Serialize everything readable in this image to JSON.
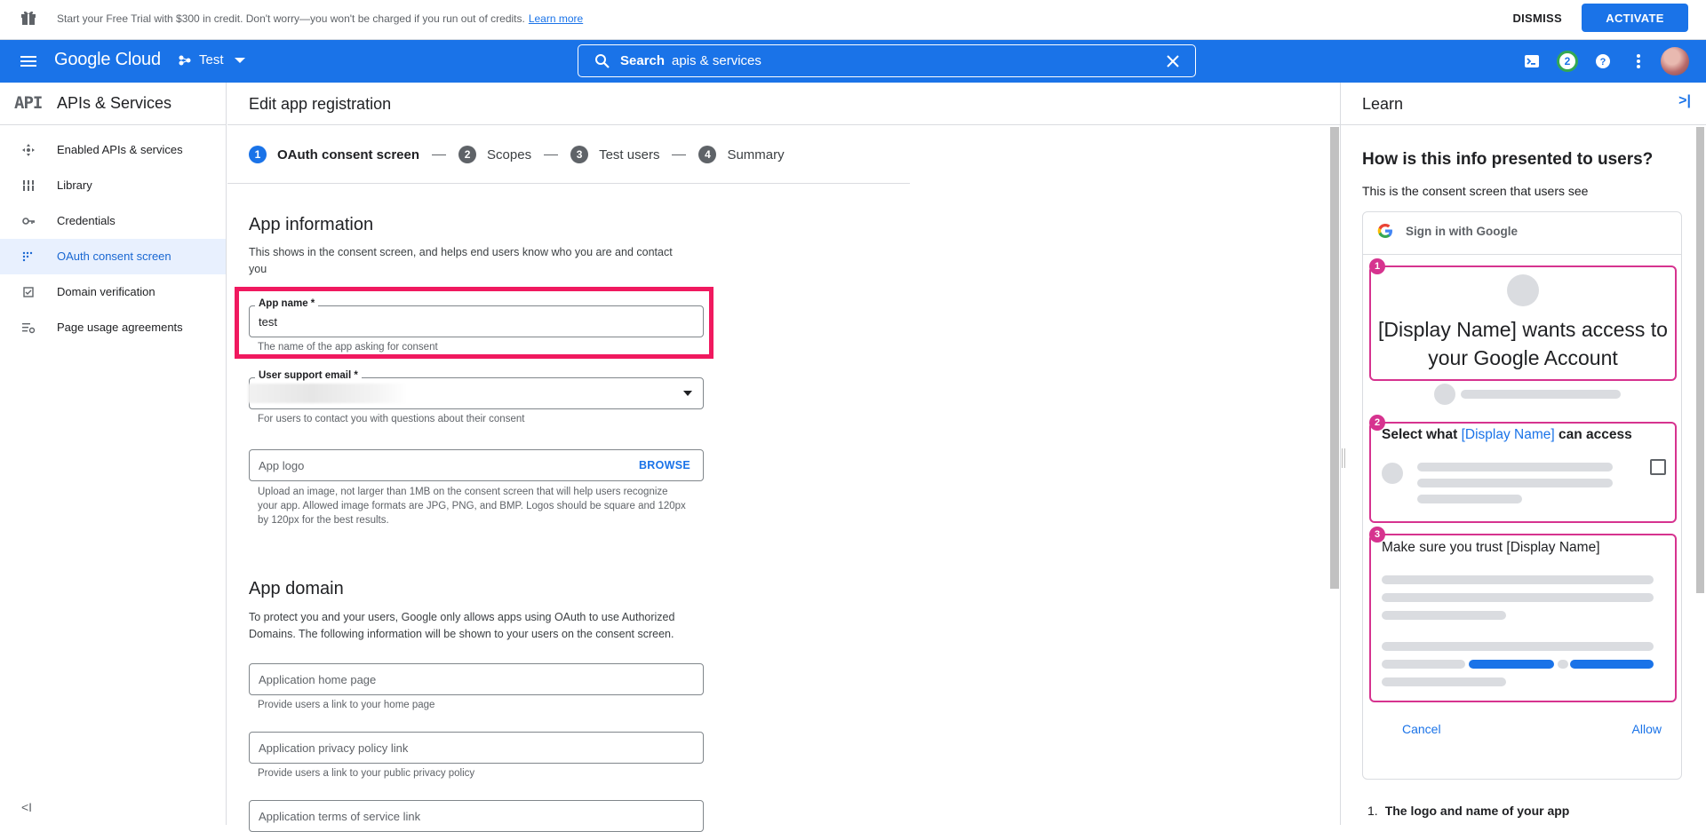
{
  "promo": {
    "text": "Start your Free Trial with $300 in credit. Don't worry—you won't be charged if you run out of credits.",
    "link": "Learn more",
    "dismiss": "DISMISS",
    "activate": "ACTIVATE"
  },
  "topbar": {
    "logo": "Google Cloud",
    "project": "Test",
    "search_label": "Search",
    "search_value": "apis & services",
    "notifications": "2"
  },
  "sidebar": {
    "logo": "API",
    "title": "APIs & Services",
    "items": [
      {
        "label": "Enabled APIs & services",
        "icon": "diamond-arrows-icon"
      },
      {
        "label": "Library",
        "icon": "library-icon"
      },
      {
        "label": "Credentials",
        "icon": "key-icon"
      },
      {
        "label": "OAuth consent screen",
        "icon": "consent-dots-icon"
      },
      {
        "label": "Domain verification",
        "icon": "checkbox-icon"
      },
      {
        "label": "Page usage agreements",
        "icon": "settings-list-icon"
      }
    ],
    "collapse": "<I"
  },
  "main": {
    "title": "Edit app registration",
    "steps": [
      {
        "num": "1",
        "label": "OAuth consent screen"
      },
      {
        "num": "2",
        "label": "Scopes"
      },
      {
        "num": "3",
        "label": "Test users"
      },
      {
        "num": "4",
        "label": "Summary"
      }
    ],
    "app_info": {
      "heading": "App information",
      "desc": "This shows in the consent screen, and helps end users know who you are and contact you",
      "app_name_label": "App name *",
      "app_name_value": "test",
      "app_name_hint": "The name of the app asking for consent",
      "email_label": "User support email *",
      "email_hint": "For users to contact you with questions about their consent",
      "logo_placeholder": "App logo",
      "browse": "BROWSE",
      "logo_hint": "Upload an image, not larger than 1MB on the consent screen that will help users recognize your app. Allowed image formats are JPG, PNG, and BMP. Logos should be square and 120px by 120px for the best results."
    },
    "app_domain": {
      "heading": "App domain",
      "desc": "To protect you and your users, Google only allows apps using OAuth to use Authorized Domains. The following information will be shown to your users on the consent screen.",
      "home_placeholder": "Application home page",
      "home_hint": "Provide users a link to your home page",
      "privacy_placeholder": "Application privacy policy link",
      "privacy_hint": "Provide users a link to your public privacy policy",
      "tos_placeholder": "Application terms of service link"
    }
  },
  "learn": {
    "title": "Learn",
    "question": "How is this info presented to users?",
    "subtitle": "This is the consent screen that users see",
    "signin": "Sign in with Google",
    "box1_num": "1",
    "box1_text": "[Display Name] wants access to your Google Account",
    "box2_num": "2",
    "box2_pre": "Select what",
    "box2_name": "[Display Name]",
    "box2_post": "can access",
    "box3_num": "3",
    "box3_text": "Make sure you trust [Display Name]",
    "cancel": "Cancel",
    "allow": "Allow",
    "list_num": "1.",
    "list_item": "The logo and name of your app"
  }
}
